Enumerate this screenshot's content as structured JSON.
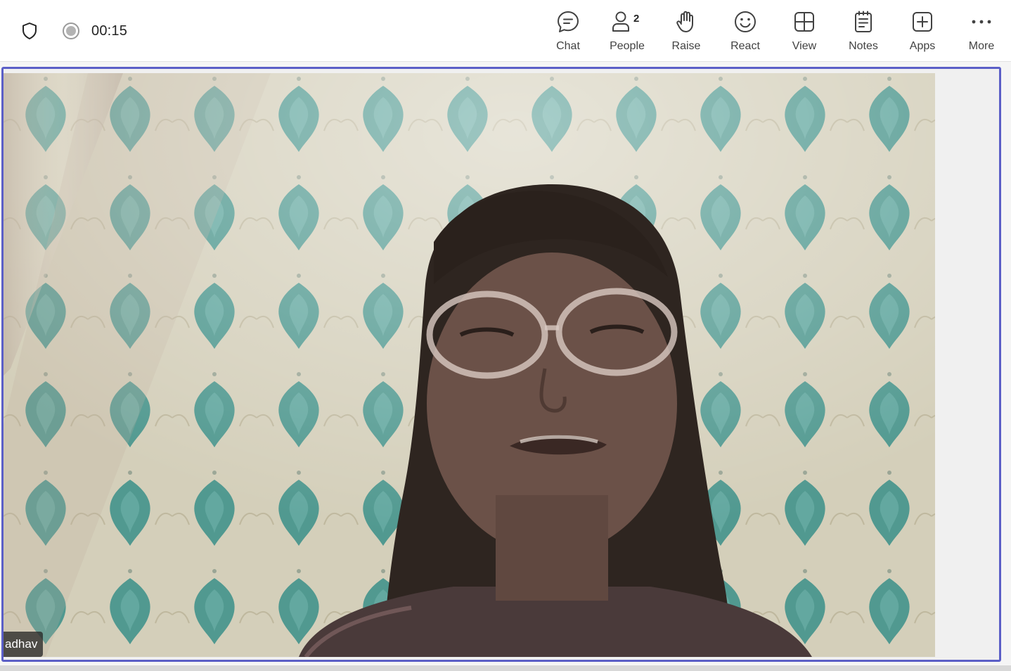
{
  "meeting": {
    "timer": "00:15"
  },
  "toolbar": {
    "chat_label": "Chat",
    "people_label": "People",
    "people_count": "2",
    "raise_label": "Raise",
    "react_label": "React",
    "view_label": "View",
    "notes_label": "Notes",
    "apps_label": "Apps",
    "more_label": "More"
  },
  "video": {
    "participant_name": "adhav"
  },
  "colors": {
    "accent": "#5b5fc7",
    "text": "#424242",
    "wall_teal": "#2f8f8a",
    "wall_cream": "#d8d2bd"
  }
}
